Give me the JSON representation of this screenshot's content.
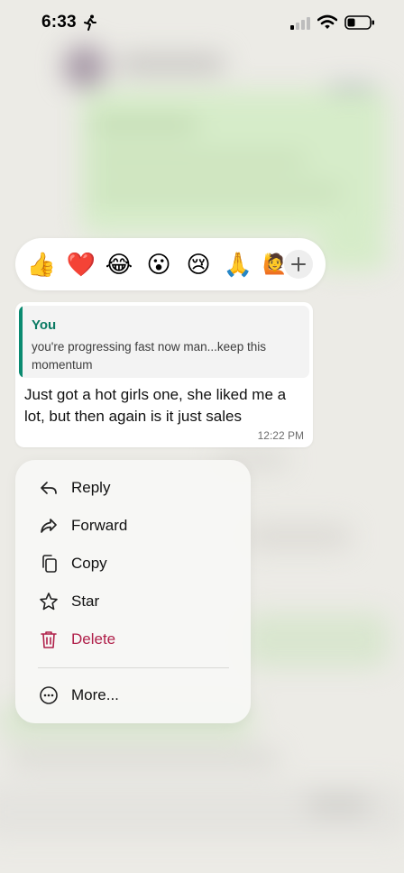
{
  "status_bar": {
    "time": "6:33"
  },
  "reactions": {
    "items": [
      {
        "emoji": "👍",
        "icon": "thumbs-up-icon"
      },
      {
        "emoji": "❤️",
        "icon": "heart-icon"
      },
      {
        "emoji": "😂",
        "icon": "tears-of-joy-icon"
      },
      {
        "emoji": "😮",
        "icon": "surprised-face-icon"
      },
      {
        "emoji": "😢",
        "icon": "crying-face-icon"
      },
      {
        "emoji": "🙏",
        "icon": "folded-hands-icon"
      },
      {
        "emoji": "🙋",
        "icon": "raising-hand-icon"
      }
    ],
    "add_icon": "plus-icon"
  },
  "message": {
    "quoted_author": "You",
    "quoted_text": "you're progressing fast now man...keep this momentum",
    "text": "Just got a hot girls one, she liked me a lot, but then again is it just sales",
    "time": "12:22 PM"
  },
  "context_menu": {
    "items": [
      {
        "label": "Reply",
        "icon": "reply-icon"
      },
      {
        "label": "Forward",
        "icon": "forward-icon"
      },
      {
        "label": "Copy",
        "icon": "copy-icon"
      },
      {
        "label": "Star",
        "icon": "star-icon"
      },
      {
        "label": "Delete",
        "icon": "trash-icon"
      },
      {
        "label": "More...",
        "icon": "more-icon"
      }
    ]
  },
  "colors": {
    "accent_green": "#0a7a63",
    "delete_red": "#b0204a",
    "bubble_bg": "#ffffff",
    "backdrop": "#ecebe6"
  }
}
